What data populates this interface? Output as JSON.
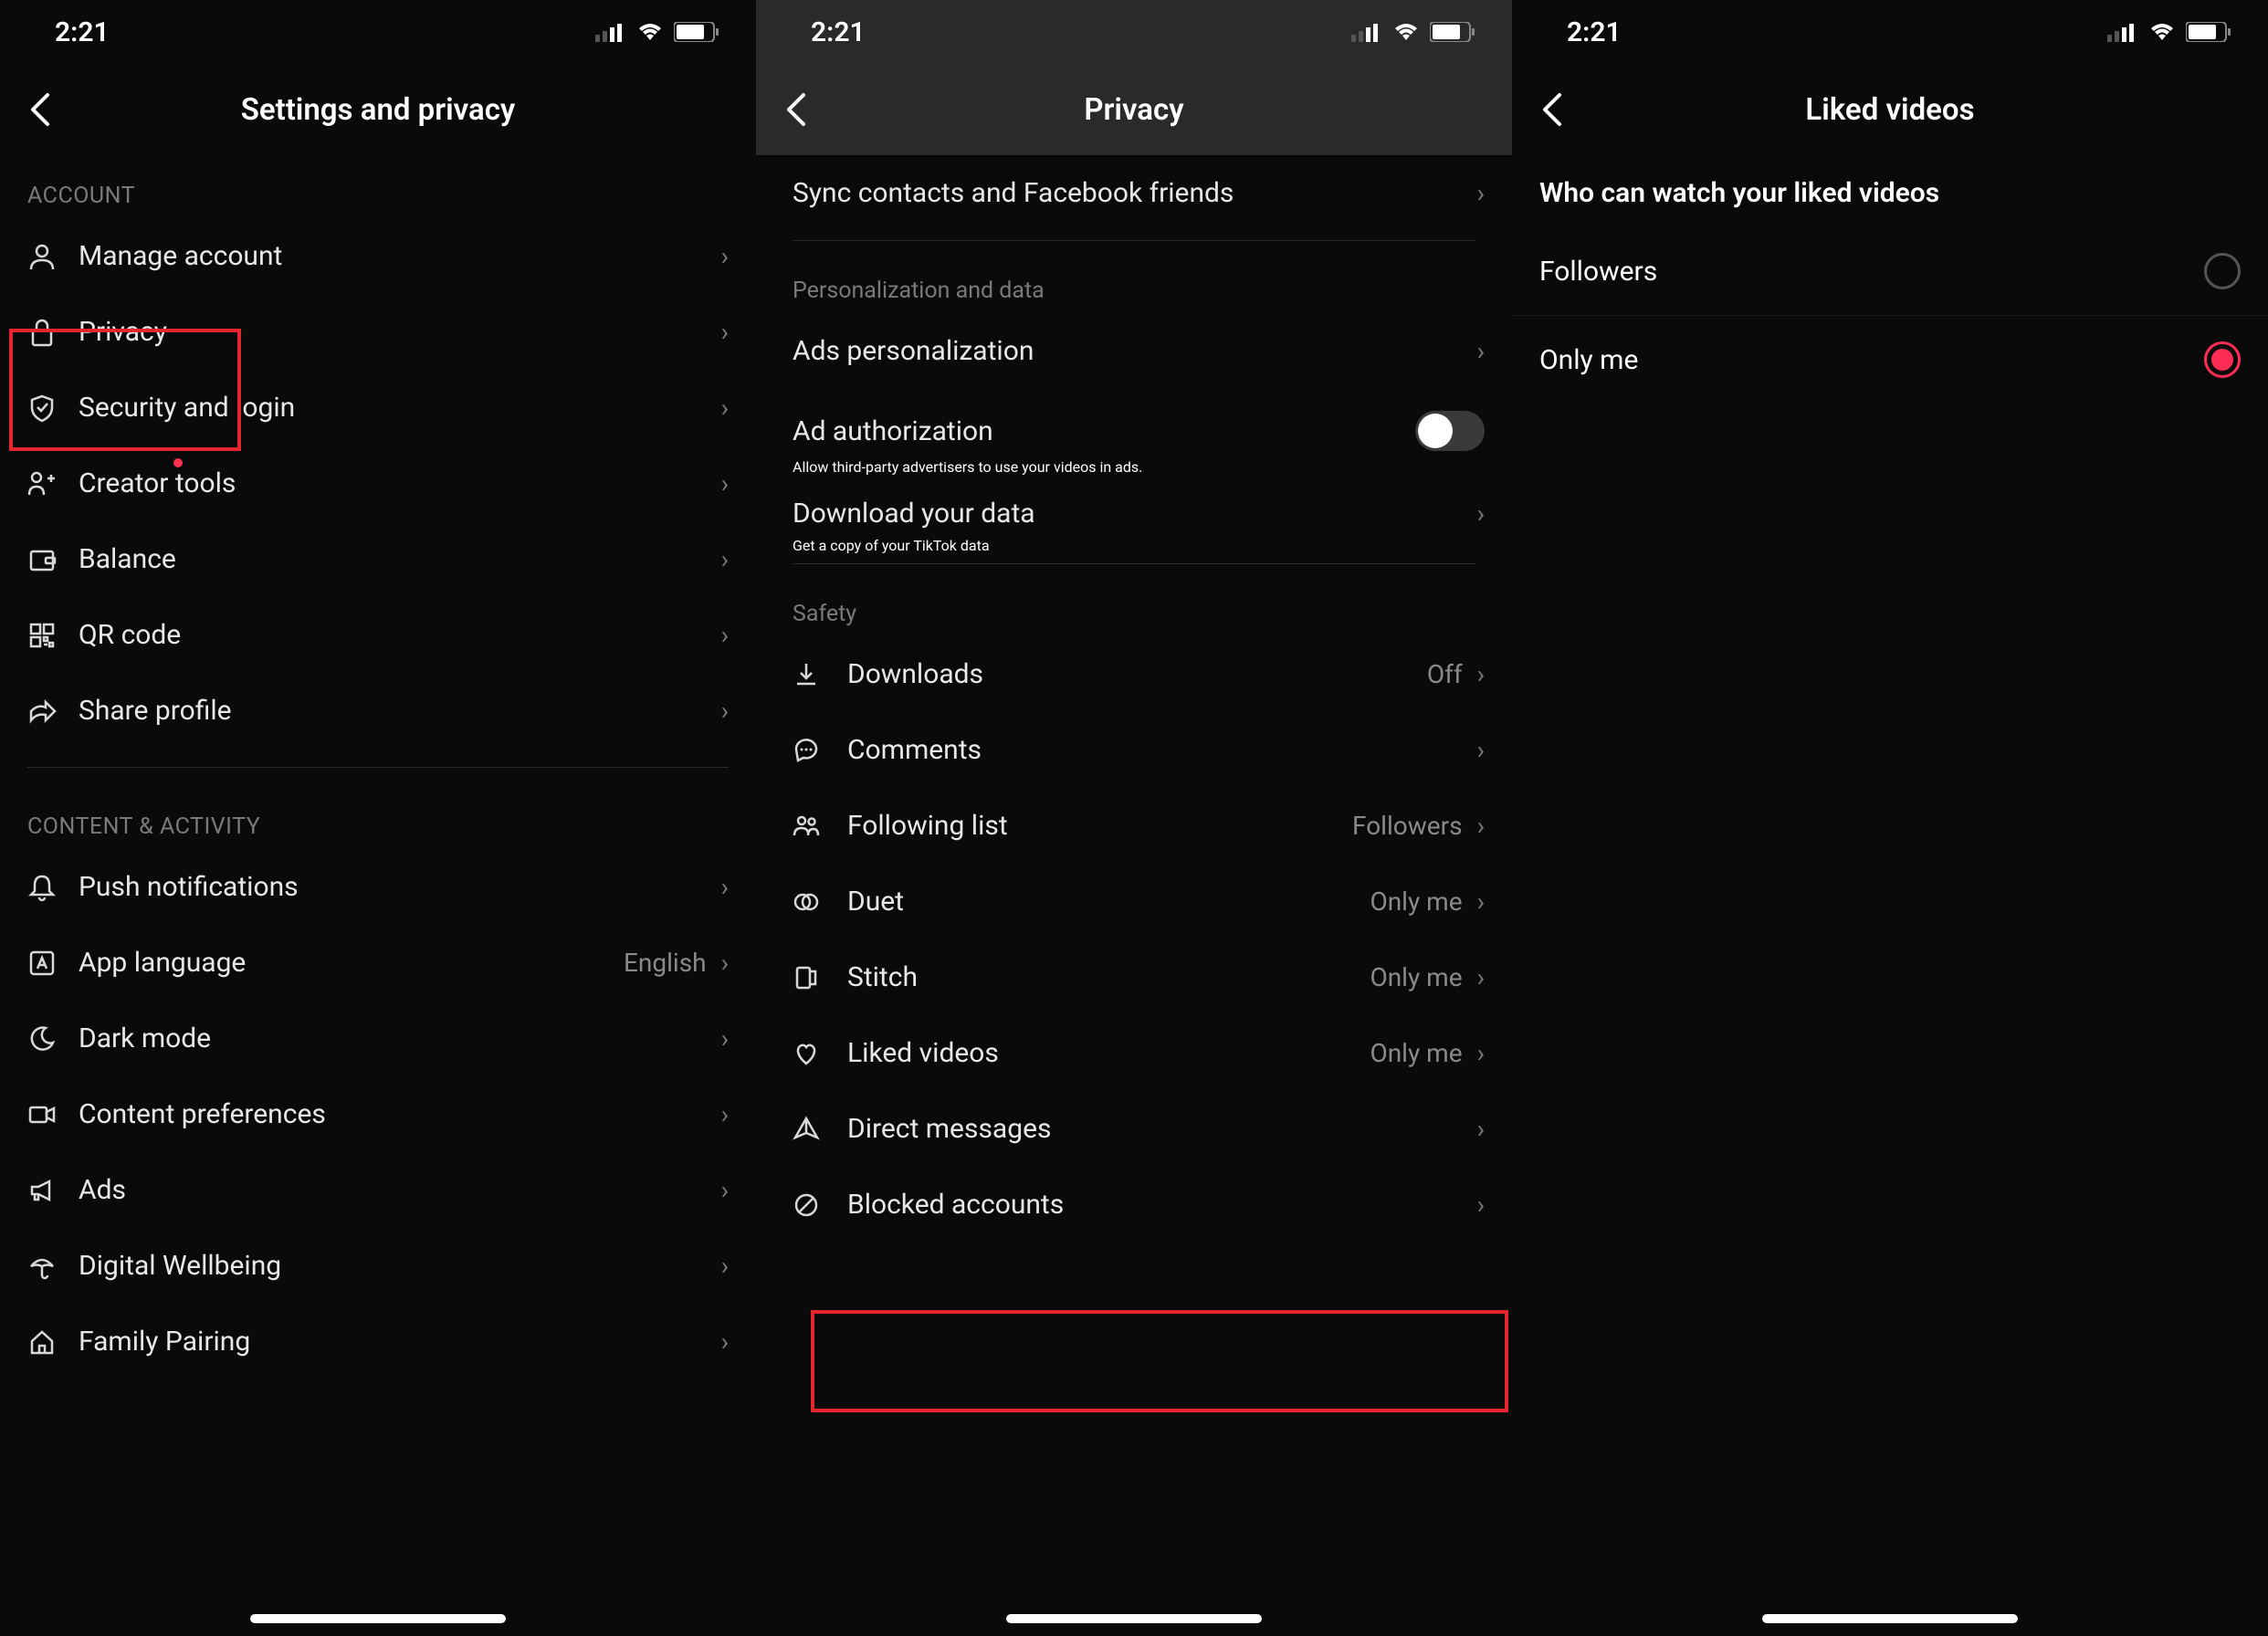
{
  "status": {
    "time": "2:21"
  },
  "screen1": {
    "title": "Settings and privacy",
    "sections": {
      "account": {
        "header": "ACCOUNT",
        "items": [
          {
            "label": "Manage account"
          },
          {
            "label": "Privacy"
          },
          {
            "label": "Security and login"
          },
          {
            "label": "Creator tools"
          },
          {
            "label": "Balance"
          },
          {
            "label": "QR code"
          },
          {
            "label": "Share profile"
          }
        ]
      },
      "content": {
        "header": "CONTENT & ACTIVITY",
        "items": [
          {
            "label": "Push notifications",
            "value": ""
          },
          {
            "label": "App language",
            "value": "English"
          },
          {
            "label": "Dark mode",
            "value": ""
          },
          {
            "label": "Content preferences",
            "value": ""
          },
          {
            "label": "Ads",
            "value": ""
          },
          {
            "label": "Digital Wellbeing",
            "value": ""
          },
          {
            "label": "Family Pairing",
            "value": ""
          }
        ]
      }
    }
  },
  "screen2": {
    "title": "Privacy",
    "sync_row": {
      "label": "Sync contacts and Facebook friends"
    },
    "pers_header": "Personalization and data",
    "ads_personalization": {
      "label": "Ads personalization"
    },
    "ad_auth": {
      "label": "Ad authorization",
      "subtitle": "Allow third-party advertisers to use your videos in ads."
    },
    "download_data": {
      "label": "Download your data",
      "subtitle": "Get a copy of your TikTok data"
    },
    "safety_header": "Safety",
    "safety": [
      {
        "label": "Downloads",
        "value": "Off"
      },
      {
        "label": "Comments",
        "value": ""
      },
      {
        "label": "Following list",
        "value": "Followers"
      },
      {
        "label": "Duet",
        "value": "Only me"
      },
      {
        "label": "Stitch",
        "value": "Only me"
      },
      {
        "label": "Liked videos",
        "value": "Only me"
      },
      {
        "label": "Direct messages",
        "value": ""
      },
      {
        "label": "Blocked accounts",
        "value": ""
      }
    ]
  },
  "screen3": {
    "title": "Liked videos",
    "heading": "Who can watch your liked videos",
    "options": [
      {
        "label": "Followers",
        "selected": false
      },
      {
        "label": "Only me",
        "selected": true
      }
    ]
  }
}
